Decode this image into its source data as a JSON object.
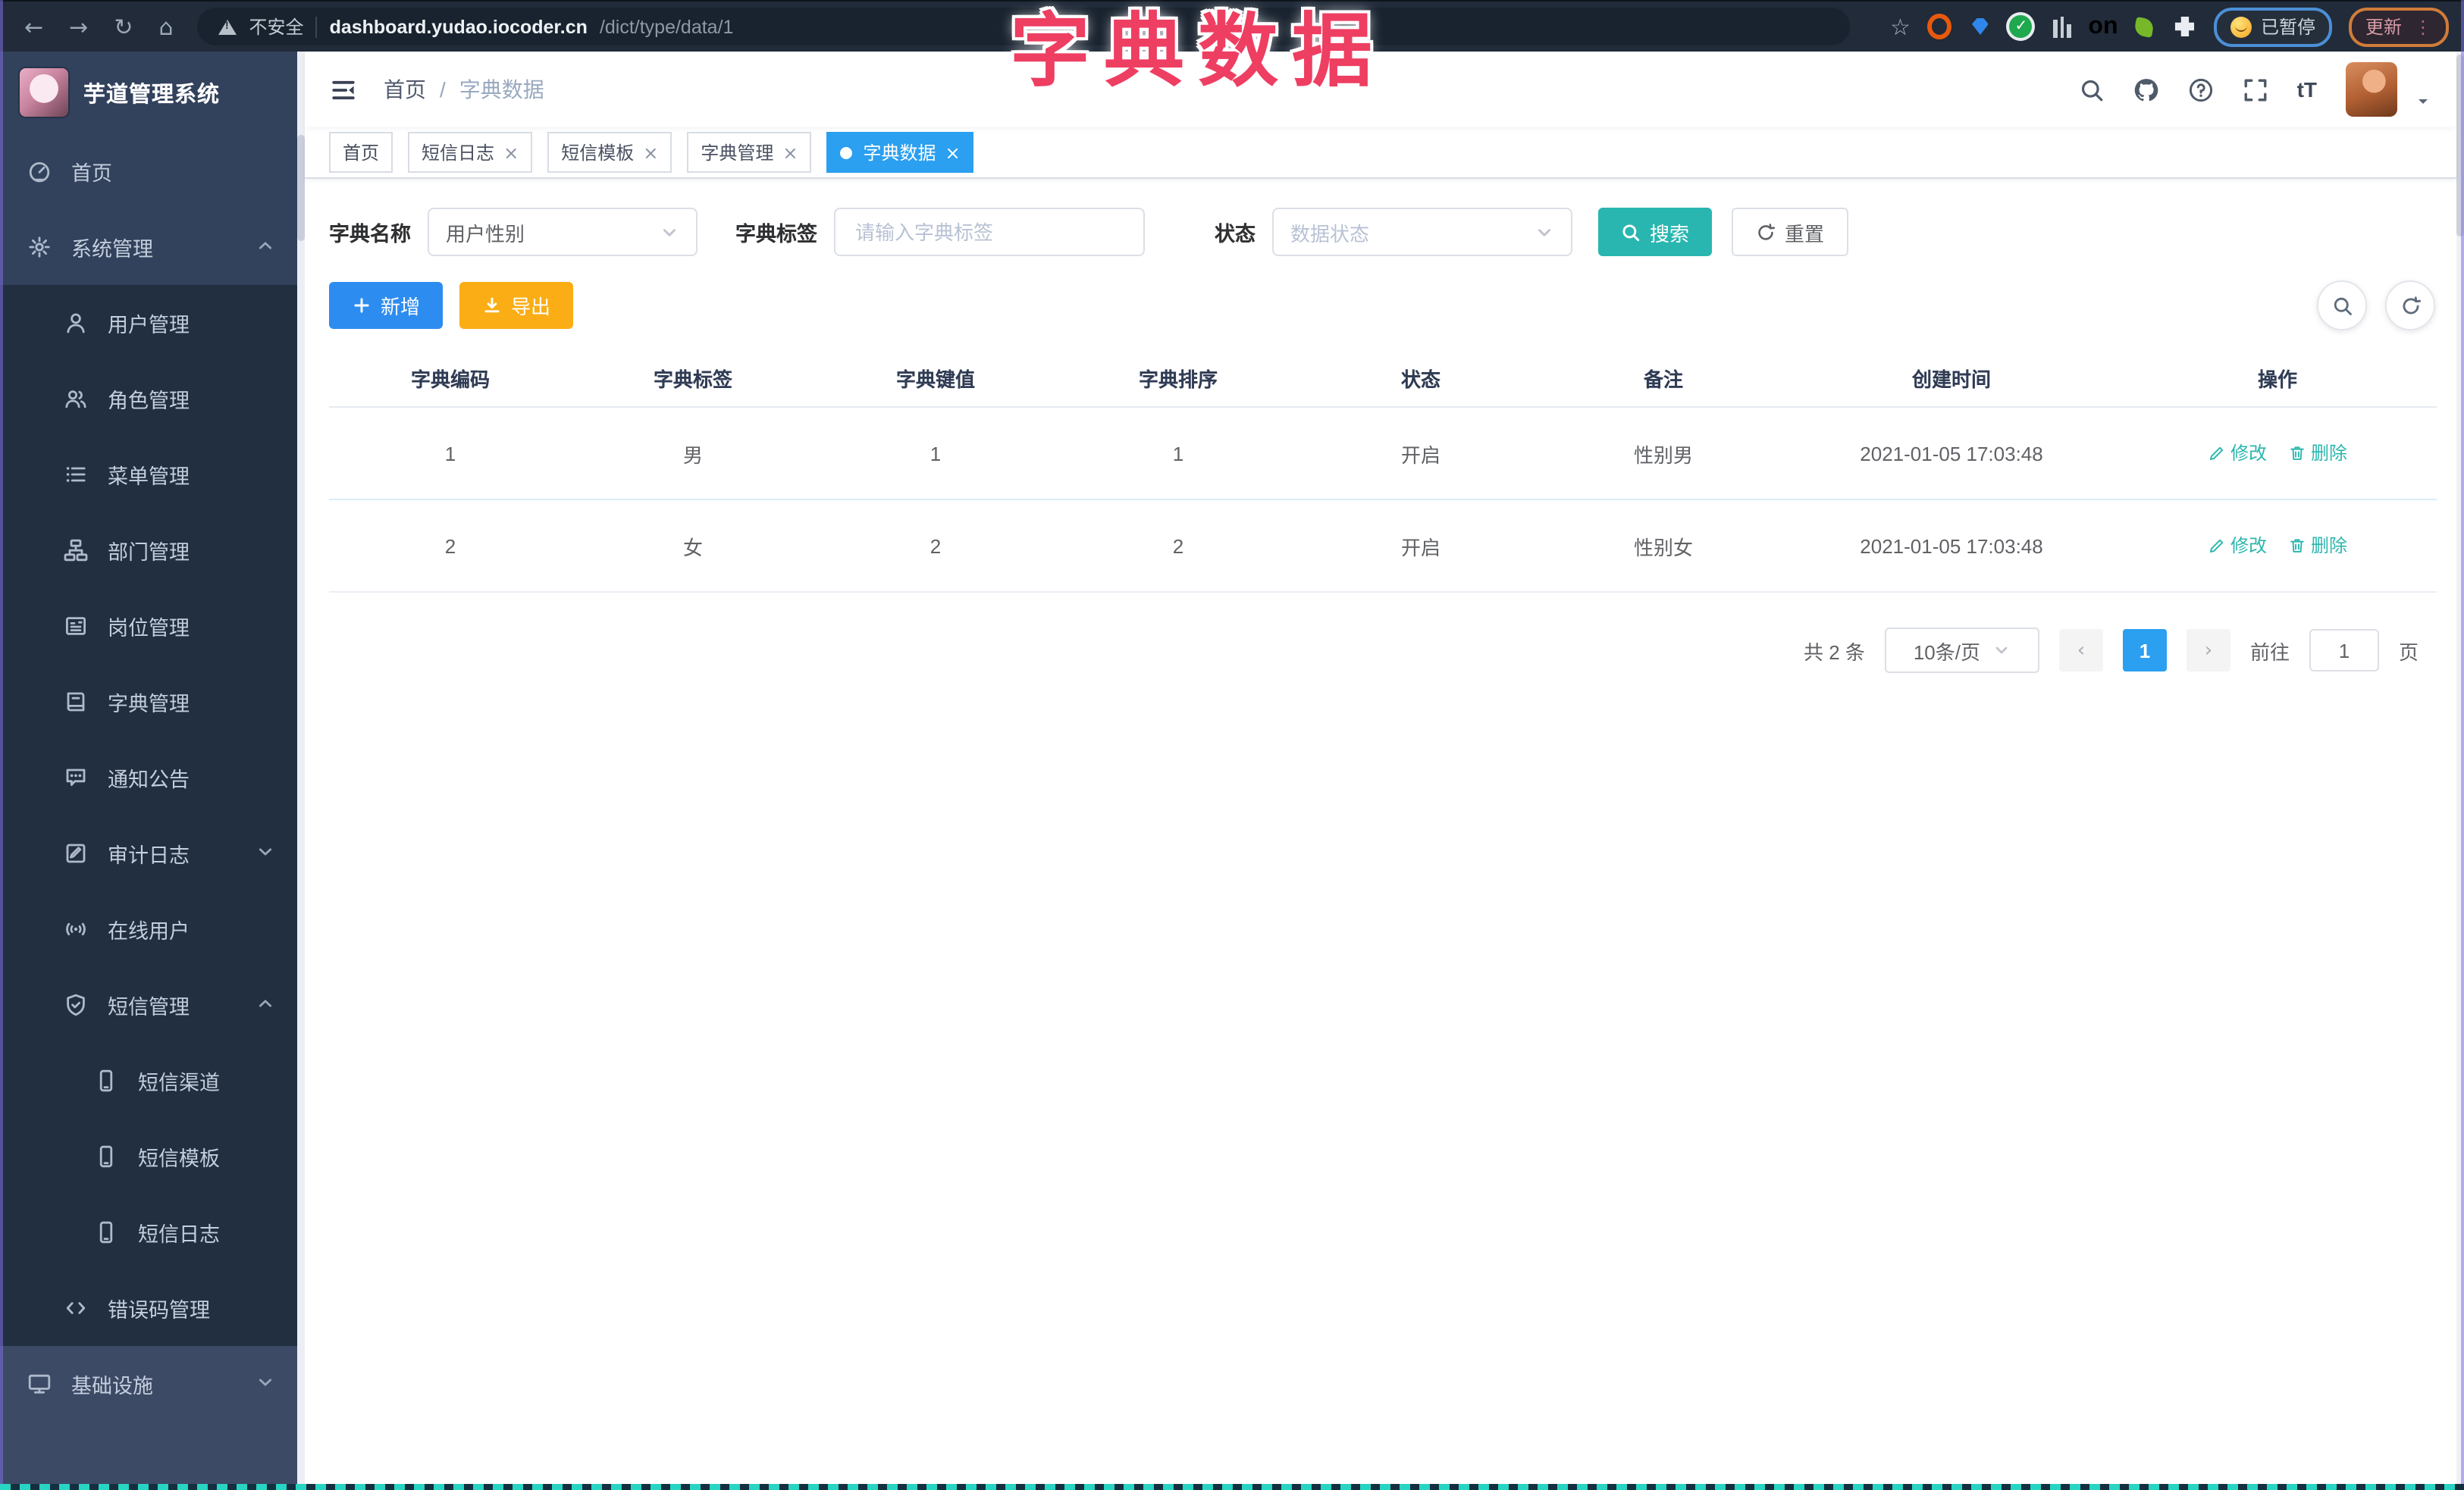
{
  "browser": {
    "security_warning": "不安全",
    "url_host": "dashboard.yudao.iocoder.cn",
    "url_path": "/dict/type/data/1",
    "paused_label": "已暂停",
    "update_label": "更新",
    "extension_on_badge": "on"
  },
  "annotation": {
    "title": "字典数据"
  },
  "sidebar": {
    "logo_title": "芋道管理系统",
    "items": [
      {
        "label": "首页",
        "icon": "dashboard-icon",
        "level": 1,
        "variant": "base"
      },
      {
        "label": "系统管理",
        "icon": "gear-icon",
        "level": 1,
        "variant": "base",
        "chevron": "up"
      },
      {
        "label": "用户管理",
        "icon": "user-icon",
        "level": 2,
        "variant": "sub"
      },
      {
        "label": "角色管理",
        "icon": "users-icon",
        "level": 2,
        "variant": "sub"
      },
      {
        "label": "菜单管理",
        "icon": "menu-list-icon",
        "level": 2,
        "variant": "sub"
      },
      {
        "label": "部门管理",
        "icon": "org-tree-icon",
        "level": 2,
        "variant": "sub"
      },
      {
        "label": "岗位管理",
        "icon": "postcard-icon",
        "level": 2,
        "variant": "sub"
      },
      {
        "label": "字典管理",
        "icon": "book-icon",
        "level": 2,
        "variant": "sub"
      },
      {
        "label": "通知公告",
        "icon": "announcement-icon",
        "level": 2,
        "variant": "sub"
      },
      {
        "label": "审计日志",
        "icon": "audit-log-icon",
        "level": 2,
        "variant": "sub",
        "chevron": "down"
      },
      {
        "label": "在线用户",
        "icon": "online-icon",
        "level": 2,
        "variant": "sub"
      },
      {
        "label": "短信管理",
        "icon": "shield-icon",
        "level": 2,
        "variant": "sub",
        "chevron": "up"
      },
      {
        "label": "短信渠道",
        "icon": "phone-icon",
        "level": 3,
        "variant": "sub"
      },
      {
        "label": "短信模板",
        "icon": "phone-icon",
        "level": 3,
        "variant": "sub"
      },
      {
        "label": "短信日志",
        "icon": "phone-icon",
        "level": 3,
        "variant": "sub"
      },
      {
        "label": "错误码管理",
        "icon": "code-icon",
        "level": 2,
        "variant": "sub"
      },
      {
        "label": "基础设施",
        "icon": "monitor-icon",
        "level": 1,
        "variant": "foot",
        "chevron": "down"
      }
    ]
  },
  "header": {
    "breadcrumb_home": "首页",
    "breadcrumb_separator": "/",
    "breadcrumb_current": "字典数据",
    "font_size_label": "tT",
    "icons": [
      "search-icon",
      "github-icon",
      "question-icon",
      "fullscreen-icon"
    ]
  },
  "tags": [
    {
      "label": "首页",
      "closable": false,
      "active": false
    },
    {
      "label": "短信日志",
      "closable": true,
      "active": false
    },
    {
      "label": "短信模板",
      "closable": true,
      "active": false
    },
    {
      "label": "字典管理",
      "closable": true,
      "active": false
    },
    {
      "label": "字典数据",
      "closable": true,
      "active": true
    }
  ],
  "filters": {
    "dict_name_label": "字典名称",
    "dict_name_value": "用户性别",
    "dict_label_label": "字典标签",
    "dict_label_placeholder": "请输入字典标签",
    "status_label": "状态",
    "status_placeholder": "数据状态",
    "search_label": "搜索",
    "reset_label": "重置"
  },
  "toolbar": {
    "add_label": "新增",
    "export_label": "导出"
  },
  "table": {
    "columns": [
      "字典编码",
      "字典标签",
      "字典键值",
      "字典排序",
      "状态",
      "备注",
      "创建时间",
      "操作"
    ],
    "rows": [
      {
        "code": "1",
        "label": "男",
        "value": "1",
        "sort": "1",
        "status": "开启",
        "remark": "性别男",
        "created": "2021-01-05 17:03:48"
      },
      {
        "code": "2",
        "label": "女",
        "value": "2",
        "sort": "2",
        "status": "开启",
        "remark": "性别女",
        "created": "2021-01-05 17:03:48"
      }
    ],
    "edit_label": "修改",
    "delete_label": "删除"
  },
  "pagination": {
    "total_text": "共 2 条",
    "page_size": "10条/页",
    "current_page": "1",
    "goto_label": "前往",
    "goto_value": "1",
    "page_unit": "页"
  },
  "colors": {
    "accent_blue": "#2b9ff0",
    "primary_button_blue": "#2d8cf0",
    "teal": "#29b6b0",
    "warning_orange": "#faad14",
    "annotation_pink": "#ee3e62",
    "sidebar_bg": "#32415c",
    "sidebar_submenu_bg": "#212f40",
    "sidebar_footer_bg": "#3d4a66",
    "chrome_bg": "#212b39"
  }
}
